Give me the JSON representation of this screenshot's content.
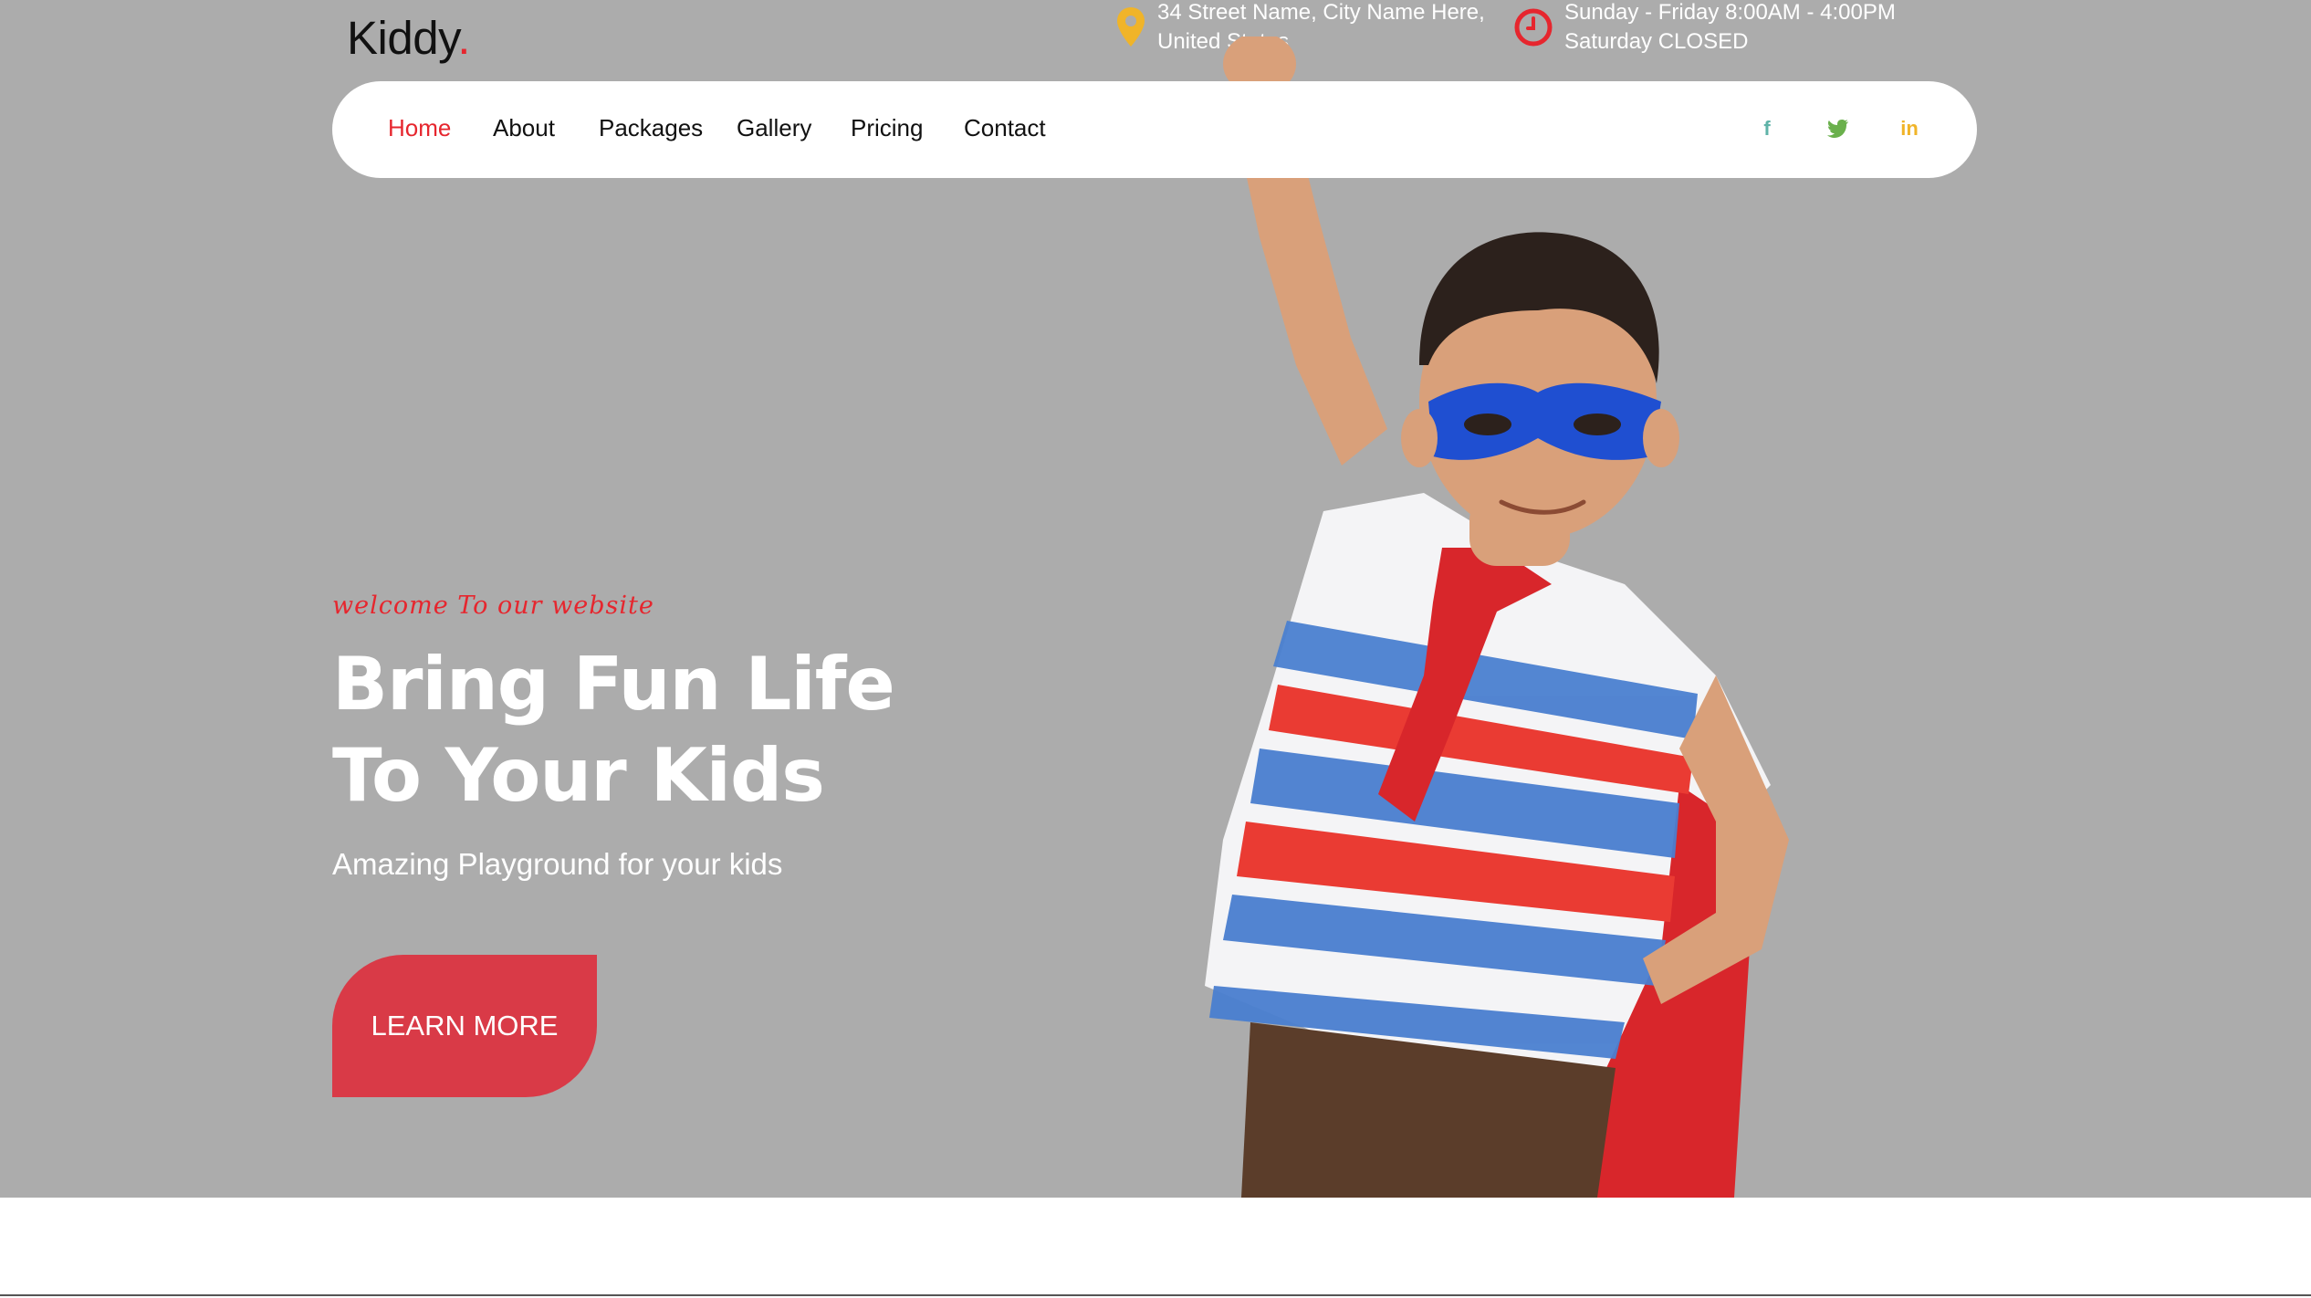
{
  "brand": {
    "name": "Kiddy",
    "dot": "."
  },
  "topbar": {
    "address_line1": "34 Street Name, City Name Here,",
    "address_line2": "United States",
    "hours_line1": "Sunday - Friday 8:00AM - 4:00PM",
    "hours_line2": "Saturday CLOSED"
  },
  "nav": {
    "items": [
      {
        "label": "Home"
      },
      {
        "label": "About"
      },
      {
        "label": "Packages"
      },
      {
        "label": "Gallery"
      },
      {
        "label": "Pricing"
      },
      {
        "label": "Contact"
      }
    ],
    "active": "Home"
  },
  "social": [
    {
      "icon": "facebook-icon",
      "glyph": "f",
      "color": "#5fb3a8"
    },
    {
      "icon": "twitter-icon",
      "glyph": "t",
      "color": "#6ab04c"
    },
    {
      "icon": "linkedin-icon",
      "glyph": "in",
      "color": "#f0b429"
    }
  ],
  "hero": {
    "welcome": "welcome To our website",
    "headline_line1": "Bring Fun Life",
    "headline_line2": "To Your Kids",
    "subline": "Amazing Playground for your kids",
    "cta_label": "LEARN MORE"
  },
  "colors": {
    "hero_bg": "#acacac",
    "accent": "#e6262e",
    "cta": "#d93a47",
    "pin": "#f0b429",
    "clock": "#e6262e"
  }
}
